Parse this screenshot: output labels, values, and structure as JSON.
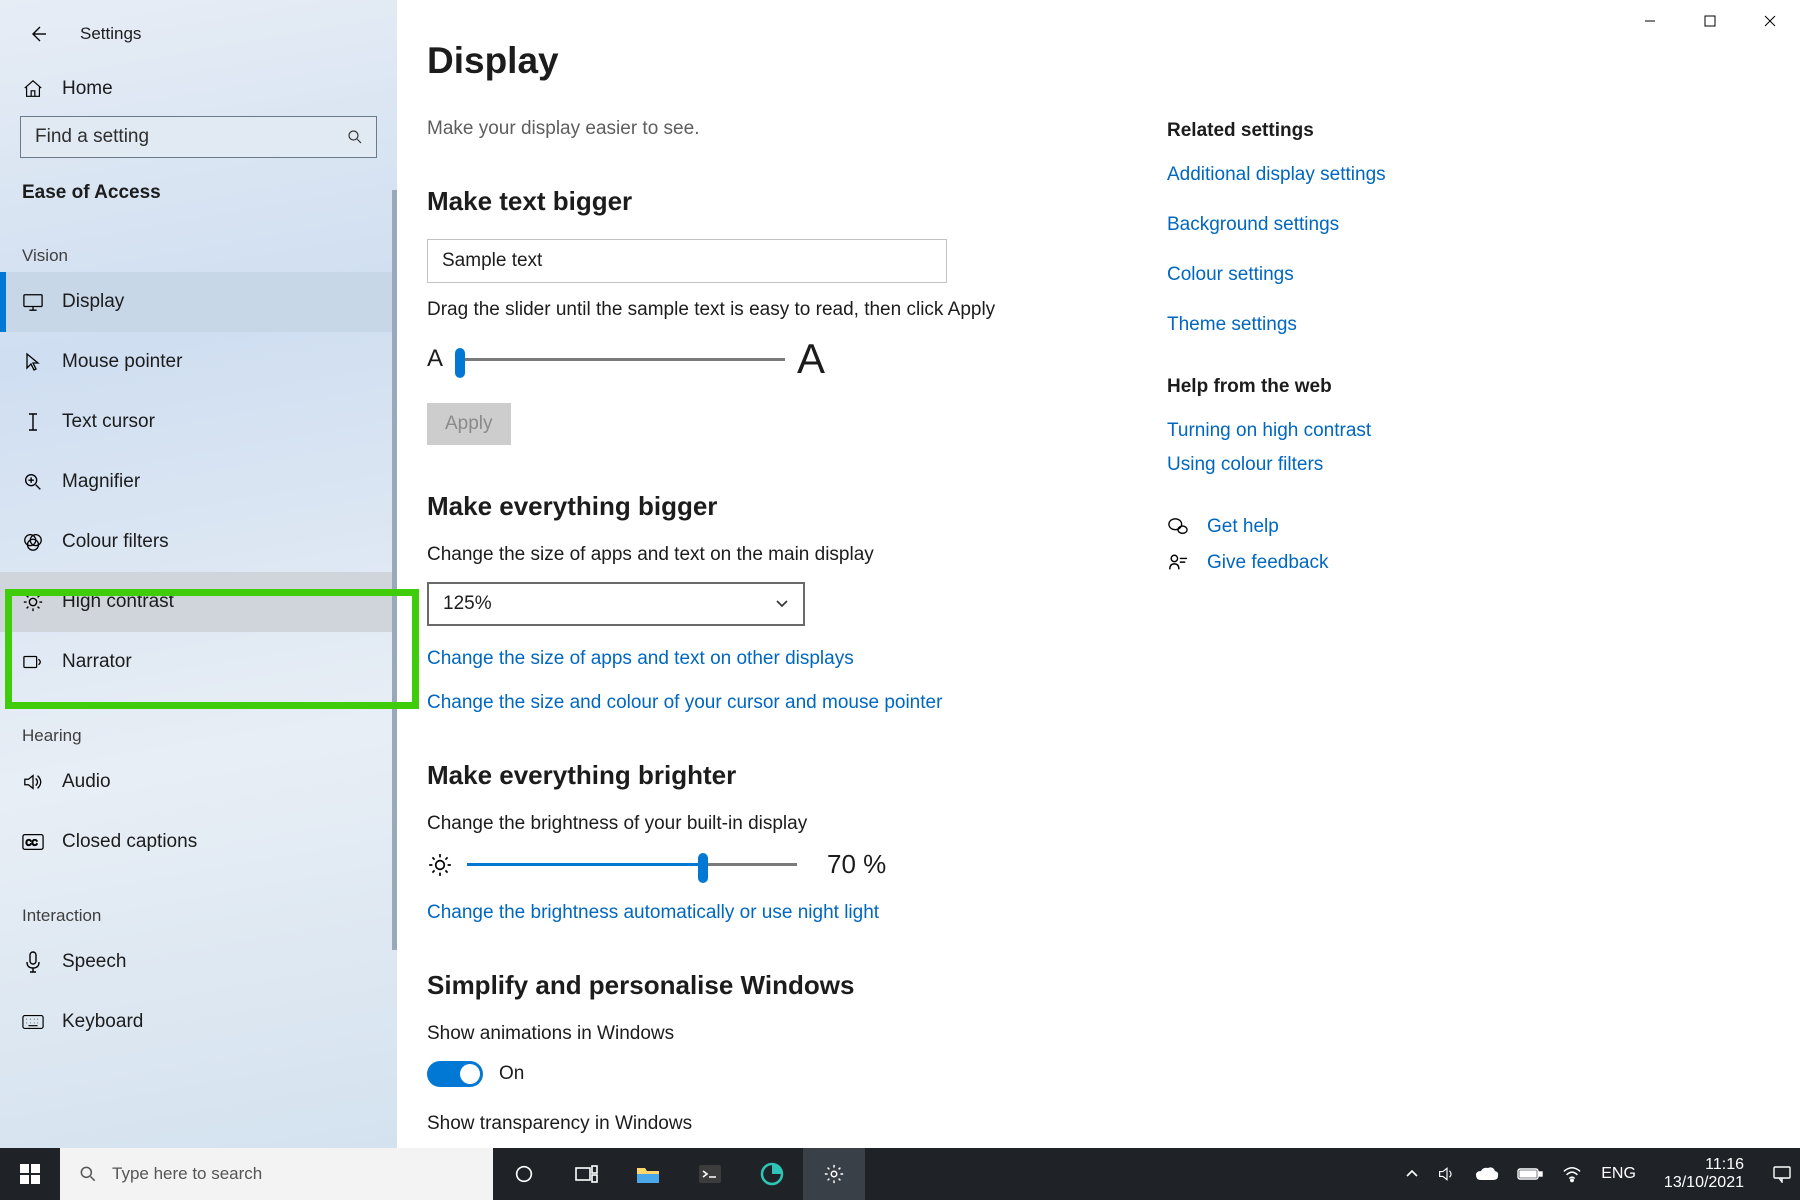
{
  "header": {
    "title": "Settings"
  },
  "sidebar": {
    "home": "Home",
    "search_placeholder": "Find a setting",
    "section": "Ease of Access",
    "groups": {
      "vision_label": "Vision",
      "hearing_label": "Hearing",
      "interaction_label": "Interaction"
    },
    "items": {
      "display": "Display",
      "mouse_pointer": "Mouse pointer",
      "text_cursor": "Text cursor",
      "magnifier": "Magnifier",
      "colour_filters": "Colour filters",
      "high_contrast": "High contrast",
      "narrator": "Narrator",
      "audio": "Audio",
      "closed_captions": "Closed captions",
      "speech": "Speech",
      "keyboard": "Keyboard"
    }
  },
  "main": {
    "title": "Display",
    "subtitle": "Make your display easier to see.",
    "make_text_bigger": {
      "heading": "Make text bigger",
      "sample": "Sample text",
      "instruction": "Drag the slider until the sample text is easy to read, then click Apply",
      "apply": "Apply"
    },
    "make_everything_bigger": {
      "heading": "Make everything bigger",
      "label": "Change the size of apps and text on the main display",
      "value": "125%",
      "link_other_displays": "Change the size of apps and text on other displays",
      "link_cursor": "Change the size and colour of your cursor and mouse pointer"
    },
    "make_brighter": {
      "heading": "Make everything brighter",
      "label": "Change the brightness of your built-in display",
      "percent": "70 %",
      "percent_value": 70,
      "link_night": "Change the brightness automatically or use night light"
    },
    "simplify": {
      "heading": "Simplify and personalise Windows",
      "anim_label": "Show animations in Windows",
      "anim_value": "On",
      "trans_label": "Show transparency in Windows"
    }
  },
  "right_rail": {
    "related_heading": "Related settings",
    "links": {
      "additional": "Additional display settings",
      "background": "Background settings",
      "colour": "Colour settings",
      "theme": "Theme settings"
    },
    "help_heading": "Help from the web",
    "help_links": {
      "high_contrast": "Turning on high contrast",
      "colour_filters": "Using colour filters"
    },
    "get_help": "Get help",
    "give_feedback": "Give feedback"
  },
  "taskbar": {
    "search_placeholder": "Type here to search",
    "lang": "ENG",
    "time": "11:16",
    "date": "13/10/2021"
  }
}
